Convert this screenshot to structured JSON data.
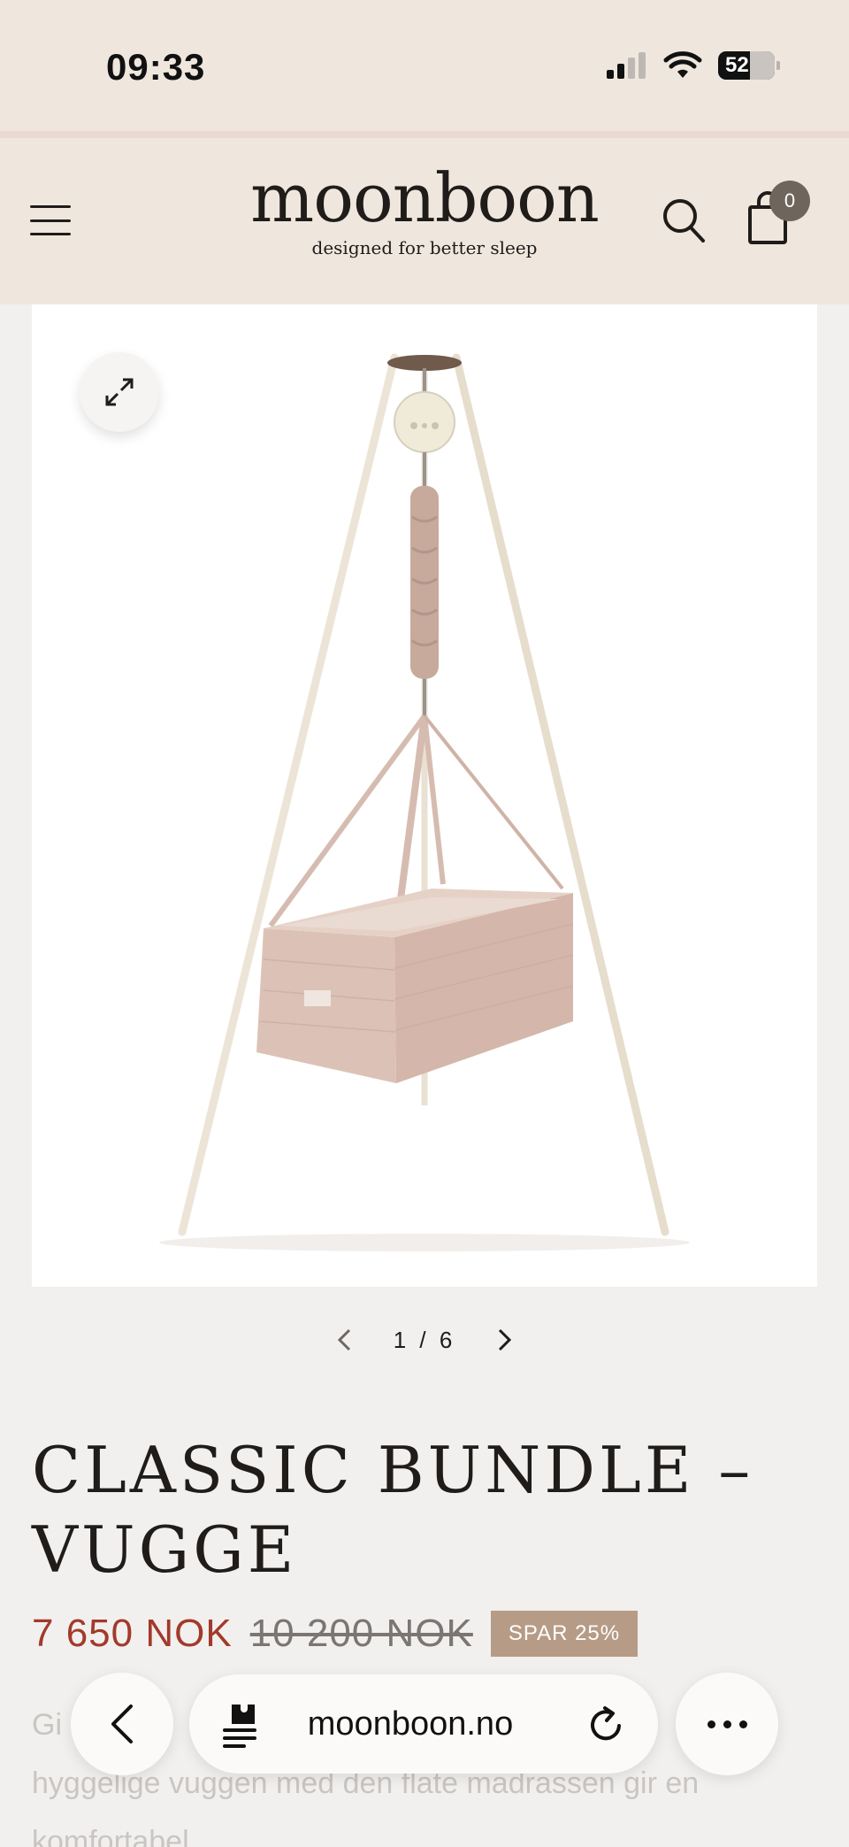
{
  "status_bar": {
    "time": "09:33",
    "battery": "52"
  },
  "header": {
    "logo_name": "moonboon",
    "logo_tagline": "designed for better sleep",
    "cart_count": "0",
    "icons": [
      "menu-icon",
      "search-icon",
      "shopping-bag-icon"
    ]
  },
  "gallery": {
    "counter": "1 / 6",
    "current": 1,
    "total": 6
  },
  "product": {
    "title_line1": "CLASSIC BUNDLE –",
    "title_line2": "VUGGE",
    "price_sale": "7 650 NOK",
    "price_original": "10 200 NOK",
    "discount_badge": "SPAR 25%",
    "description_line1": "Gi                                                                                n",
    "description_line2": "hyggelige vuggen med den flate madrassen gir en",
    "description_line3": "komfortabel..."
  },
  "browser_toolbar": {
    "url": "moonboon.no"
  },
  "colors": {
    "header_bg": "#efe7de",
    "page_bg": "#f2f0ee",
    "sale_price": "#a23a2b",
    "badge_bg": "#b69b86",
    "cradle": "#dcc2b6",
    "stand": "#ece4d6"
  }
}
